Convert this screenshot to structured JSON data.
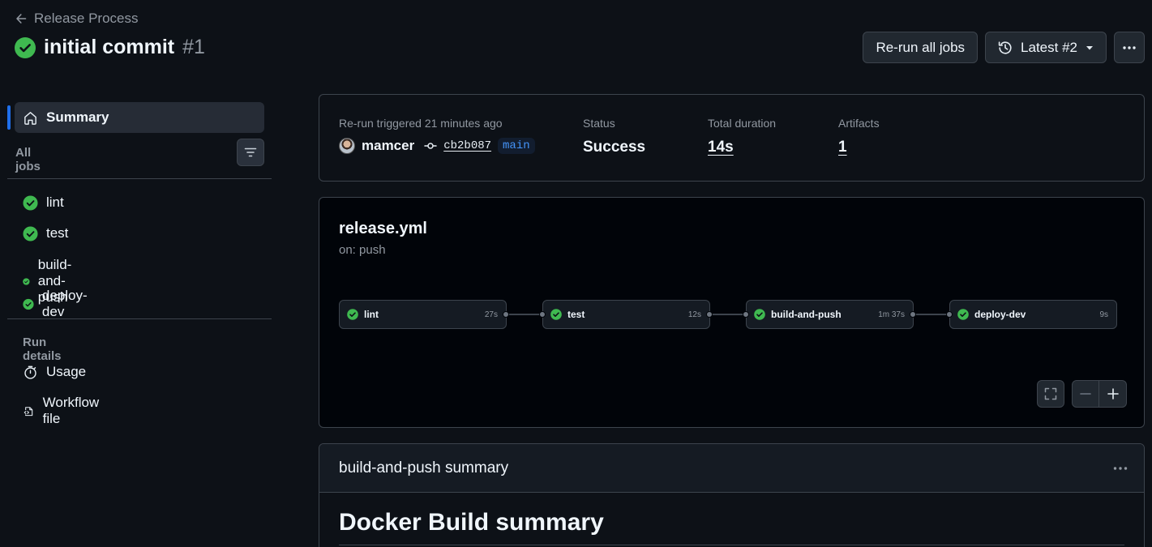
{
  "header": {
    "back_label": "Release Process",
    "title": "initial commit",
    "run_number": "#1",
    "rerun_label": "Re-run all jobs",
    "latest_label": "Latest #2"
  },
  "sidebar": {
    "summary_label": "Summary",
    "all_jobs_label": "All jobs",
    "jobs": [
      "lint",
      "test",
      "build-and-push",
      "deploy-dev"
    ],
    "run_details_label": "Run details",
    "details": [
      "Usage",
      "Workflow file"
    ]
  },
  "summary": {
    "trigger_label": "Re-run triggered 21 minutes ago",
    "actor": "mamcer",
    "commit_sha": "cb2b087",
    "branch": "main",
    "status_label": "Status",
    "status_value": "Success",
    "duration_label": "Total duration",
    "duration_value": "14s",
    "artifacts_label": "Artifacts",
    "artifacts_value": "1"
  },
  "graph": {
    "workflow_file": "release.yml",
    "trigger": "on: push",
    "nodes": [
      {
        "name": "lint",
        "duration": "27s"
      },
      {
        "name": "test",
        "duration": "12s"
      },
      {
        "name": "build-and-push",
        "duration": "1m 37s"
      },
      {
        "name": "deploy-dev",
        "duration": "9s"
      }
    ]
  },
  "step_summary": {
    "title": "build-and-push summary",
    "heading": "Docker Build summary"
  },
  "colors": {
    "background": "#0d1117",
    "success": "#3fb950",
    "accent": "#1f6feb",
    "border": "#3d444d",
    "muted_text": "#9198a1"
  }
}
